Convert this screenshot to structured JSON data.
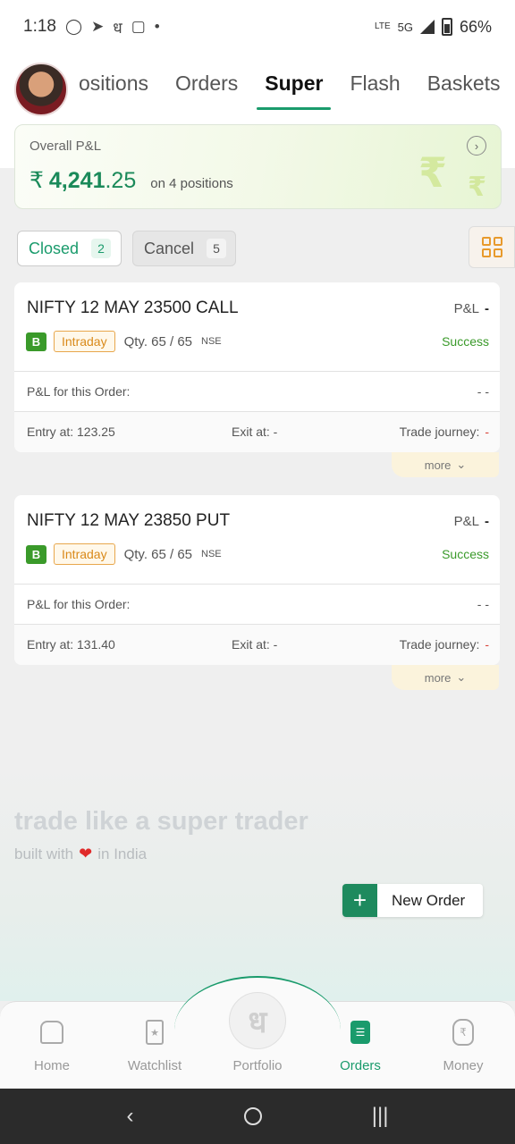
{
  "status_bar": {
    "time": "1:18",
    "network": "5G",
    "lte": "LTE",
    "battery": "66%"
  },
  "tabs": [
    {
      "label": "ositions"
    },
    {
      "label": "Orders"
    },
    {
      "label": "Super"
    },
    {
      "label": "Flash"
    },
    {
      "label": "Baskets"
    }
  ],
  "pl_card": {
    "label": "Overall P&L",
    "currency": "₹",
    "amount_int": "4,241",
    "amount_dec": ".25",
    "positions": "on 4 positions"
  },
  "filters": {
    "closed": {
      "label": "Closed",
      "count": "2"
    },
    "cancel": {
      "label": "Cancel",
      "count": "5"
    }
  },
  "orders": [
    {
      "name": "NIFTY 12 MAY 23500 CALL",
      "pl_label": "P&L",
      "pl_value": "-",
      "side": "B",
      "product": "Intraday",
      "qty": "Qty. 65 / 65",
      "exchange": "NSE",
      "status": "Success",
      "pl_order_label": "P&L for this Order:",
      "pl_order_value": "- -",
      "entry": "Entry at:  123.25",
      "exit": "Exit at:  -",
      "journey_label": "Trade journey:",
      "journey_value": "-",
      "more": "more"
    },
    {
      "name": "NIFTY 12 MAY 23850 PUT",
      "pl_label": "P&L",
      "pl_value": "-",
      "side": "B",
      "product": "Intraday",
      "qty": "Qty. 65 / 65",
      "exchange": "NSE",
      "status": "Success",
      "pl_order_label": "P&L for this Order:",
      "pl_order_value": "- -",
      "entry": "Entry at:  131.40",
      "exit": "Exit at:  -",
      "journey_label": "Trade journey:",
      "journey_value": "-",
      "more": "more"
    }
  ],
  "tagline": "trade like a super trader",
  "built_with": {
    "before": "built with",
    "after": "in India"
  },
  "new_order": {
    "label": "New Order"
  },
  "bottom_nav": [
    {
      "label": "Home",
      "icon": "home-icon"
    },
    {
      "label": "Watchlist",
      "icon": "bookmark-icon"
    },
    {
      "label": "Portfolio",
      "icon": "portfolio-icon"
    },
    {
      "label": "Orders",
      "icon": "orders-icon"
    },
    {
      "label": "Money",
      "icon": "moneybag-icon"
    }
  ],
  "colors": {
    "accent": "#1a9b6c",
    "success": "#3a9a2a",
    "intraday": "#e8a74c",
    "danger": "#d9453a"
  }
}
